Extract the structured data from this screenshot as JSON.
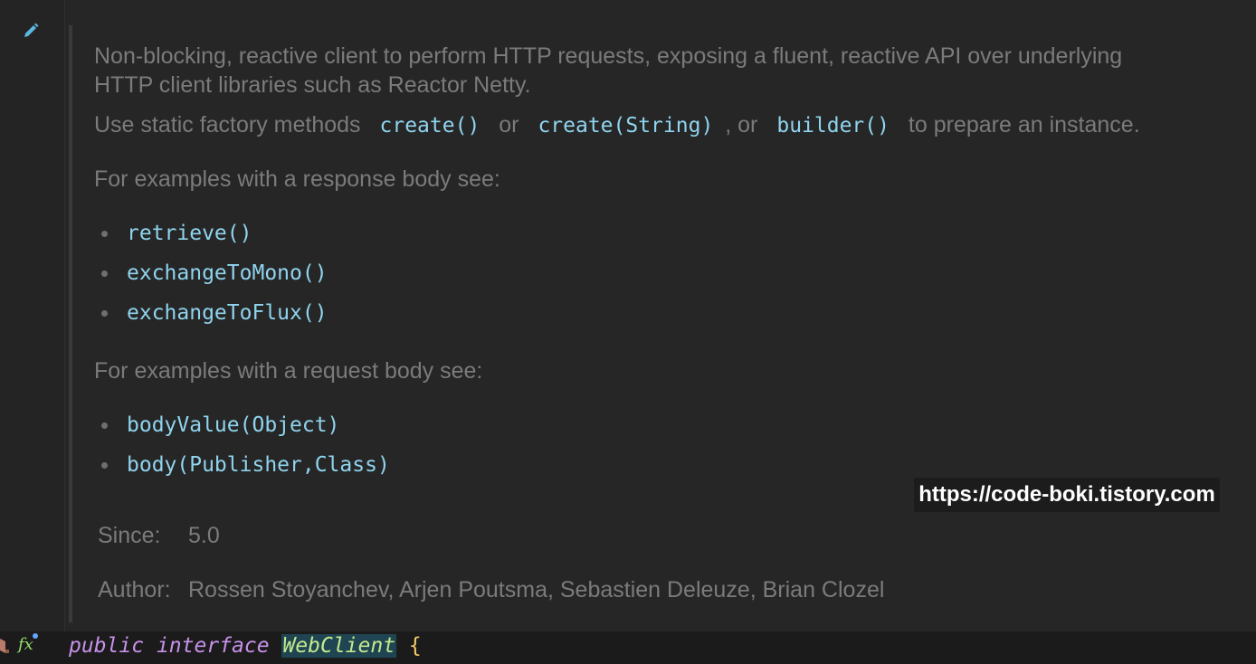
{
  "doc": {
    "intro_line1": "Non-blocking, reactive client to perform HTTP requests, exposing a fluent, reactive API over underlying",
    "intro_line2": "HTTP client libraries such as Reactor Netty.",
    "use_prefix": "Use static factory methods",
    "method_create": "create()",
    "or1": "or",
    "method_create_string": "create(String)",
    "comma_or": ", or",
    "method_builder": "builder()",
    "use_suffix": "to prepare an instance.",
    "response_heading": "For examples with a response body see:",
    "response_items": [
      "retrieve()",
      "exchangeToMono()",
      "exchangeToFlux()"
    ],
    "request_heading": "For examples with a request body see:",
    "request_items": [
      "bodyValue(Object)",
      "body(Publisher,Class)"
    ],
    "since_label": "Since:",
    "since_value": "5.0",
    "author_label": "Author:",
    "author_value": "Rossen Stoyanchev, Arjen Poutsma, Sebastien Deleuze, Brian Clozel"
  },
  "watermark": "https://code-boki.tistory.com",
  "code_line": {
    "kw_public": "public",
    "kw_interface": "interface",
    "name": "WebClient",
    "brace": "{"
  },
  "gutter": {
    "icons": [
      "edit-pencil-icon",
      "function-fx-icon",
      "library-icon"
    ],
    "fx_text": "fx"
  },
  "colors": {
    "background": "#242424",
    "code_link": "#8fd4ee",
    "doc_text": "#7b7b7b",
    "keyword": "#c792ea",
    "interface_name": "#c3e88d",
    "brace": "#f4c767"
  }
}
